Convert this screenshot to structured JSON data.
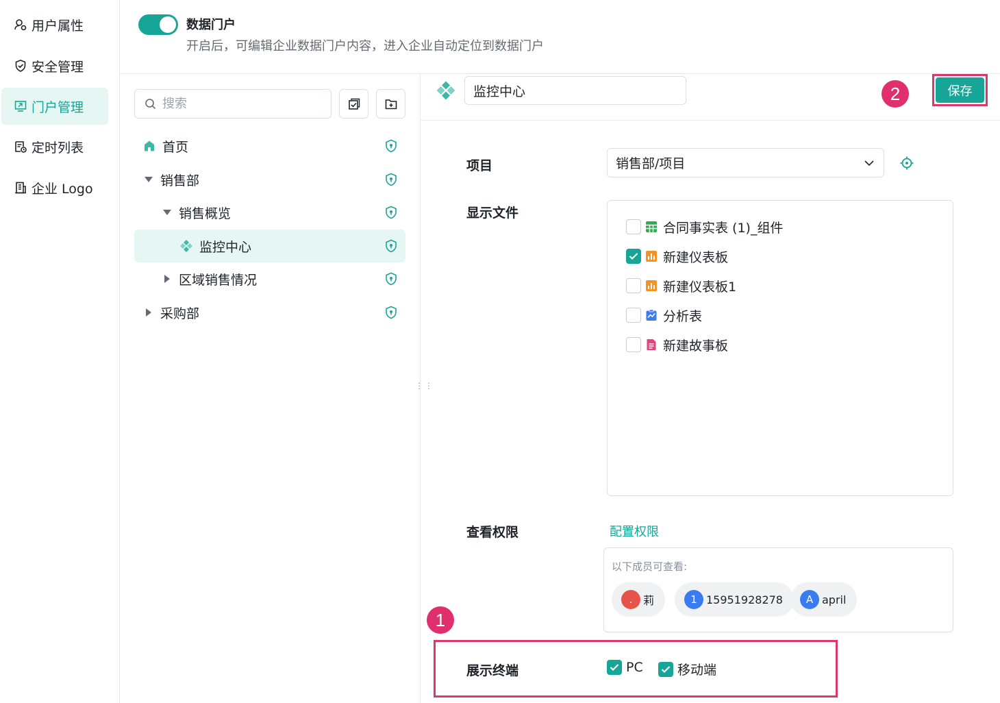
{
  "sidebar": {
    "items": [
      {
        "label": "用户属性",
        "icon": "user-attribute-icon"
      },
      {
        "label": "安全管理",
        "icon": "shield-icon"
      },
      {
        "label": "门户管理",
        "icon": "portal-icon",
        "active": true
      },
      {
        "label": "定时列表",
        "icon": "schedule-icon"
      },
      {
        "label": "企业 Logo",
        "icon": "building-icon"
      }
    ]
  },
  "portal": {
    "enabled": true,
    "title": "数据门户",
    "description": "开启后，可编辑企业数据门户内容，进入企业自动定位到数据门户"
  },
  "tree": {
    "search_placeholder": "搜索",
    "nodes": [
      {
        "label": "首页"
      },
      {
        "label": "销售部",
        "expanded": true
      },
      {
        "label": "销售概览",
        "expanded": true
      },
      {
        "label": "监控中心",
        "selected": true
      },
      {
        "label": "区域销售情况",
        "expanded": false
      },
      {
        "label": "采购部",
        "expanded": false
      }
    ]
  },
  "editor": {
    "name_value": "监控中心",
    "save_label": "保存",
    "annotation_1": "1",
    "annotation_2": "2",
    "project_label": "项目",
    "project_value": "销售部/项目",
    "files_label": "显示文件",
    "files": [
      {
        "label": "合同事实表 (1)_组件",
        "checked": false,
        "icon": "table-icon",
        "color": "#34a853"
      },
      {
        "label": "新建仪表板",
        "checked": true,
        "icon": "dashboard-icon",
        "color": "#f29325"
      },
      {
        "label": "新建仪表板1",
        "checked": false,
        "icon": "dashboard-icon",
        "color": "#f29325"
      },
      {
        "label": "分析表",
        "checked": false,
        "icon": "analysis-icon",
        "color": "#3a7bf0"
      },
      {
        "label": "新建故事板",
        "checked": false,
        "icon": "storyboard-icon",
        "color": "#e0457b"
      }
    ],
    "permission_label": "查看权限",
    "permission_link": "配置权限",
    "members_caption": "以下成员可查看:",
    "members": [
      {
        "avatar": ".",
        "name": "莉",
        "color": "#e5534b"
      },
      {
        "avatar": "1",
        "name": "15951928278",
        "color": "#3a7bf0"
      },
      {
        "avatar": "A",
        "name": "april",
        "color": "#3a7bf0"
      }
    ],
    "terminal_label": "展示终端",
    "terminals": [
      {
        "label": "PC",
        "checked": true
      },
      {
        "label": "移动端",
        "checked": true
      }
    ]
  },
  "colors": {
    "accent": "#17a597",
    "highlight": "#d9376e",
    "badge": "#e02f6c"
  }
}
